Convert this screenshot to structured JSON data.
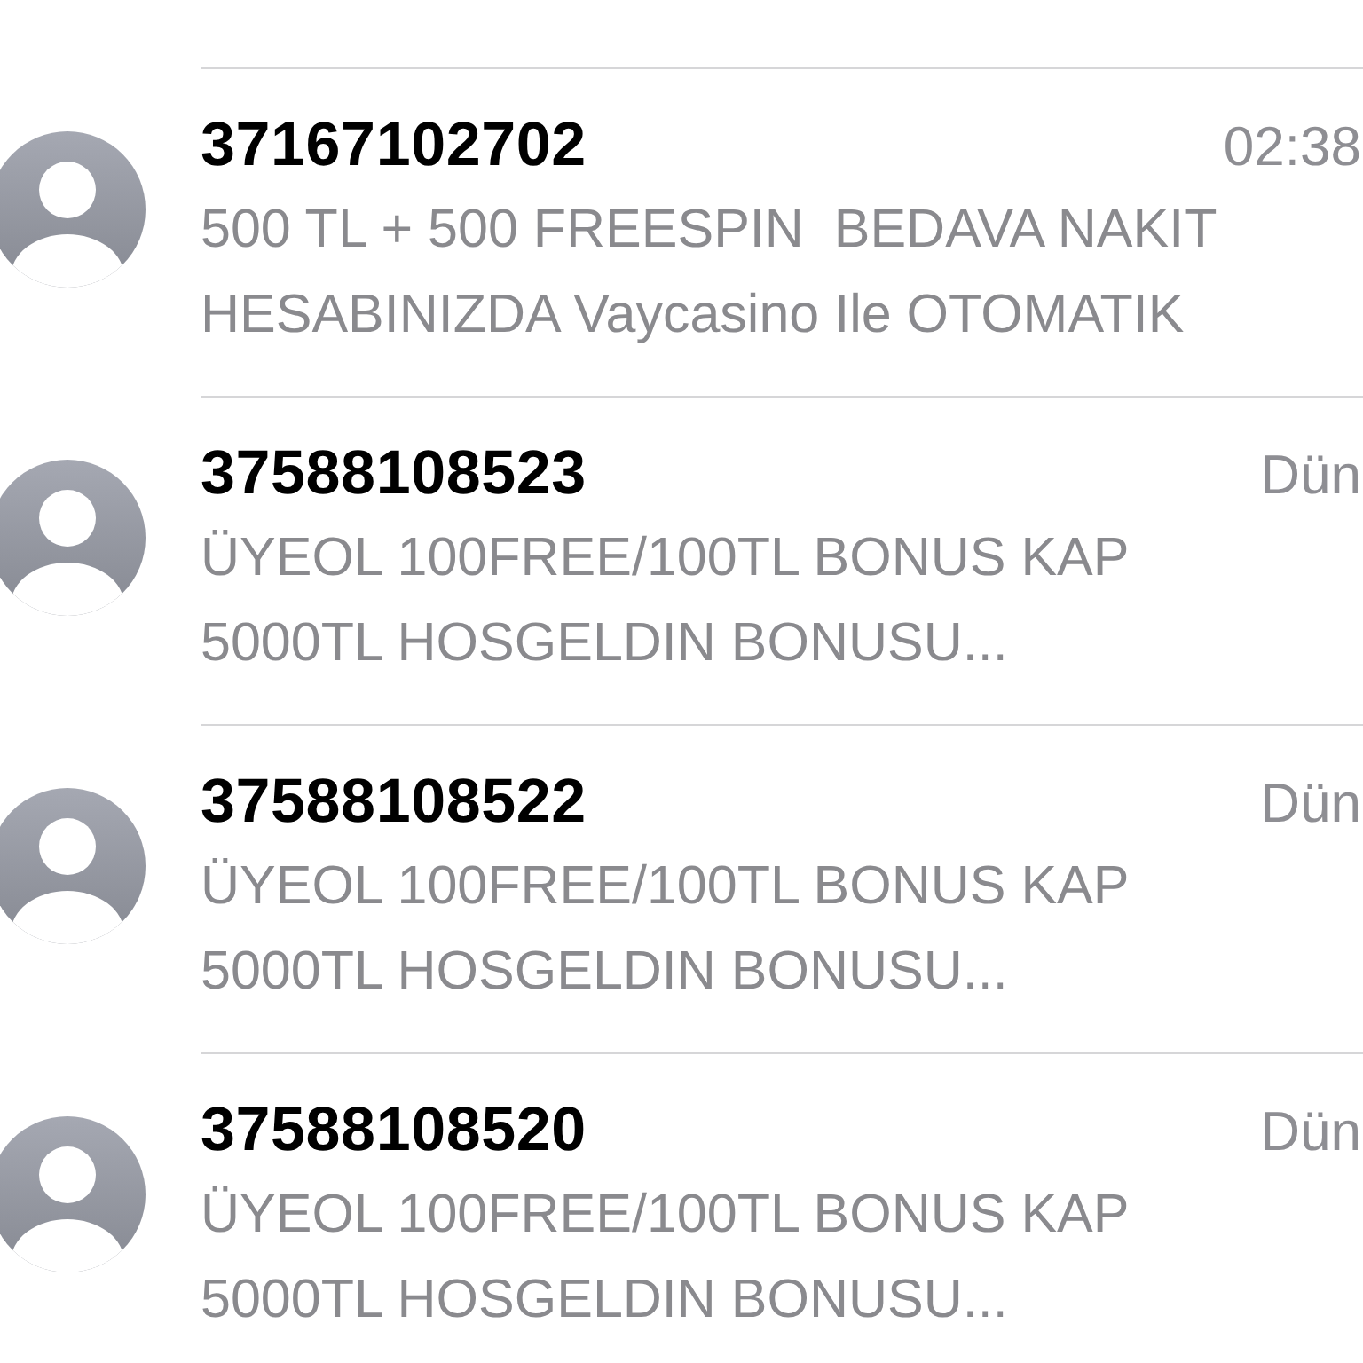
{
  "messages": [
    {
      "sender": "37167102702",
      "time": "02:38",
      "preview_lines": [
        "500 TL + 500 FREESPIN  BEDAVA NAKIT",
        "HESABINIZDA Vaycasino Ile OTOMATIK"
      ]
    },
    {
      "sender": "37588108523",
      "time": "Dün",
      "preview_lines": [
        "ÜYEOL 100FREE/100TL BONUS KAP",
        "5000TL HOSGELDIN BONUSU..."
      ]
    },
    {
      "sender": "37588108522",
      "time": "Dün",
      "preview_lines": [
        "ÜYEOL 100FREE/100TL BONUS KAP",
        "5000TL HOSGELDIN BONUSU..."
      ]
    },
    {
      "sender": "37588108520",
      "time": "Dün",
      "preview_lines": [
        "ÜYEOL 100FREE/100TL BONUS KAP",
        "5000TL HOSGELDIN BONUSU..."
      ]
    }
  ]
}
